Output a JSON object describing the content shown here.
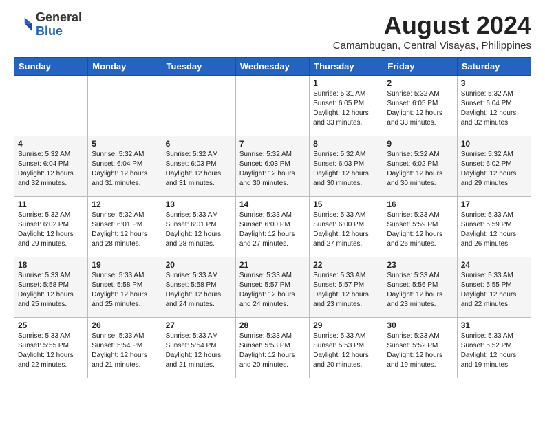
{
  "header": {
    "logo_general": "General",
    "logo_blue": "Blue",
    "month_title": "August 2024",
    "location": "Camambugan, Central Visayas, Philippines"
  },
  "weekdays": [
    "Sunday",
    "Monday",
    "Tuesday",
    "Wednesday",
    "Thursday",
    "Friday",
    "Saturday"
  ],
  "weeks": [
    [
      {
        "day": "",
        "content": ""
      },
      {
        "day": "",
        "content": ""
      },
      {
        "day": "",
        "content": ""
      },
      {
        "day": "",
        "content": ""
      },
      {
        "day": "1",
        "content": "Sunrise: 5:31 AM\nSunset: 6:05 PM\nDaylight: 12 hours\nand 33 minutes."
      },
      {
        "day": "2",
        "content": "Sunrise: 5:32 AM\nSunset: 6:05 PM\nDaylight: 12 hours\nand 33 minutes."
      },
      {
        "day": "3",
        "content": "Sunrise: 5:32 AM\nSunset: 6:04 PM\nDaylight: 12 hours\nand 32 minutes."
      }
    ],
    [
      {
        "day": "4",
        "content": "Sunrise: 5:32 AM\nSunset: 6:04 PM\nDaylight: 12 hours\nand 32 minutes."
      },
      {
        "day": "5",
        "content": "Sunrise: 5:32 AM\nSunset: 6:04 PM\nDaylight: 12 hours\nand 31 minutes."
      },
      {
        "day": "6",
        "content": "Sunrise: 5:32 AM\nSunset: 6:03 PM\nDaylight: 12 hours\nand 31 minutes."
      },
      {
        "day": "7",
        "content": "Sunrise: 5:32 AM\nSunset: 6:03 PM\nDaylight: 12 hours\nand 30 minutes."
      },
      {
        "day": "8",
        "content": "Sunrise: 5:32 AM\nSunset: 6:03 PM\nDaylight: 12 hours\nand 30 minutes."
      },
      {
        "day": "9",
        "content": "Sunrise: 5:32 AM\nSunset: 6:02 PM\nDaylight: 12 hours\nand 30 minutes."
      },
      {
        "day": "10",
        "content": "Sunrise: 5:32 AM\nSunset: 6:02 PM\nDaylight: 12 hours\nand 29 minutes."
      }
    ],
    [
      {
        "day": "11",
        "content": "Sunrise: 5:32 AM\nSunset: 6:02 PM\nDaylight: 12 hours\nand 29 minutes."
      },
      {
        "day": "12",
        "content": "Sunrise: 5:32 AM\nSunset: 6:01 PM\nDaylight: 12 hours\nand 28 minutes."
      },
      {
        "day": "13",
        "content": "Sunrise: 5:33 AM\nSunset: 6:01 PM\nDaylight: 12 hours\nand 28 minutes."
      },
      {
        "day": "14",
        "content": "Sunrise: 5:33 AM\nSunset: 6:00 PM\nDaylight: 12 hours\nand 27 minutes."
      },
      {
        "day": "15",
        "content": "Sunrise: 5:33 AM\nSunset: 6:00 PM\nDaylight: 12 hours\nand 27 minutes."
      },
      {
        "day": "16",
        "content": "Sunrise: 5:33 AM\nSunset: 5:59 PM\nDaylight: 12 hours\nand 26 minutes."
      },
      {
        "day": "17",
        "content": "Sunrise: 5:33 AM\nSunset: 5:59 PM\nDaylight: 12 hours\nand 26 minutes."
      }
    ],
    [
      {
        "day": "18",
        "content": "Sunrise: 5:33 AM\nSunset: 5:58 PM\nDaylight: 12 hours\nand 25 minutes."
      },
      {
        "day": "19",
        "content": "Sunrise: 5:33 AM\nSunset: 5:58 PM\nDaylight: 12 hours\nand 25 minutes."
      },
      {
        "day": "20",
        "content": "Sunrise: 5:33 AM\nSunset: 5:58 PM\nDaylight: 12 hours\nand 24 minutes."
      },
      {
        "day": "21",
        "content": "Sunrise: 5:33 AM\nSunset: 5:57 PM\nDaylight: 12 hours\nand 24 minutes."
      },
      {
        "day": "22",
        "content": "Sunrise: 5:33 AM\nSunset: 5:57 PM\nDaylight: 12 hours\nand 23 minutes."
      },
      {
        "day": "23",
        "content": "Sunrise: 5:33 AM\nSunset: 5:56 PM\nDaylight: 12 hours\nand 23 minutes."
      },
      {
        "day": "24",
        "content": "Sunrise: 5:33 AM\nSunset: 5:55 PM\nDaylight: 12 hours\nand 22 minutes."
      }
    ],
    [
      {
        "day": "25",
        "content": "Sunrise: 5:33 AM\nSunset: 5:55 PM\nDaylight: 12 hours\nand 22 minutes."
      },
      {
        "day": "26",
        "content": "Sunrise: 5:33 AM\nSunset: 5:54 PM\nDaylight: 12 hours\nand 21 minutes."
      },
      {
        "day": "27",
        "content": "Sunrise: 5:33 AM\nSunset: 5:54 PM\nDaylight: 12 hours\nand 21 minutes."
      },
      {
        "day": "28",
        "content": "Sunrise: 5:33 AM\nSunset: 5:53 PM\nDaylight: 12 hours\nand 20 minutes."
      },
      {
        "day": "29",
        "content": "Sunrise: 5:33 AM\nSunset: 5:53 PM\nDaylight: 12 hours\nand 20 minutes."
      },
      {
        "day": "30",
        "content": "Sunrise: 5:33 AM\nSunset: 5:52 PM\nDaylight: 12 hours\nand 19 minutes."
      },
      {
        "day": "31",
        "content": "Sunrise: 5:33 AM\nSunset: 5:52 PM\nDaylight: 12 hours\nand 19 minutes."
      }
    ]
  ]
}
